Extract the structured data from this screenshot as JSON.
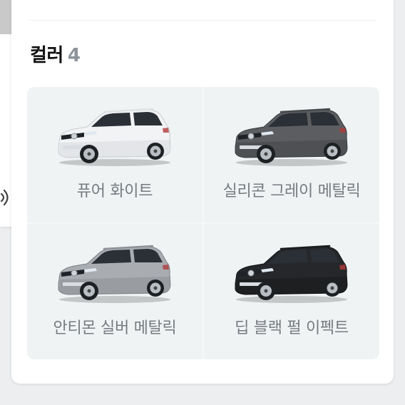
{
  "section": {
    "title": "컬러",
    "count": "4"
  },
  "colors": [
    {
      "label": "퓨어 화이트",
      "body": "#f2f3f4",
      "shade": "#c9ccd0",
      "roof": "#dfe2e5"
    },
    {
      "label": "실리콘 그레이 메탈릭",
      "body": "#5b5d60",
      "shade": "#36383b",
      "roof": "#46484b"
    },
    {
      "label": "안티몬 실버 메탈릭",
      "body": "#a9acb1",
      "shade": "#7c8086",
      "roof": "#8f9398"
    },
    {
      "label": "딥 블랙 펄 이펙트",
      "body": "#26272a",
      "shade": "#0f1012",
      "roof": "#1a1b1d"
    }
  ],
  "icons": {
    "audio": "speaker-wave-icon"
  }
}
